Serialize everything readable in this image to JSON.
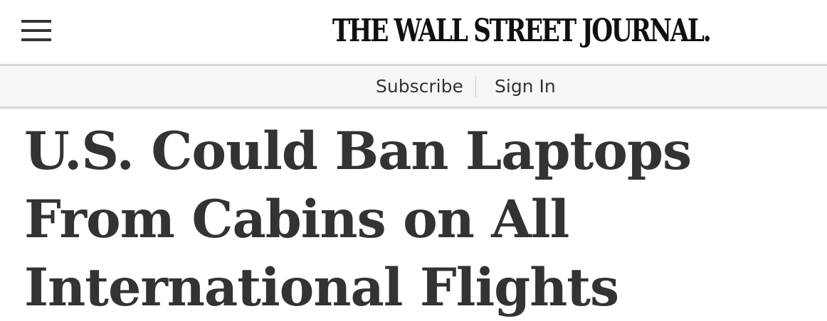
{
  "header": {
    "menu_icon": "hamburger-menu-icon",
    "logo_text": "THE WALL STREET JOURNAL."
  },
  "subbar": {
    "subscribe_label": "Subscribe",
    "signin_label": "Sign In"
  },
  "article": {
    "headline": "U.S. Could Ban Laptops From Cabins on All International Flights"
  },
  "colors": {
    "headline": "#333333",
    "logo": "#111111",
    "subbar_background": "#f6f6f6",
    "subbar_border": "#d6d6d6"
  }
}
